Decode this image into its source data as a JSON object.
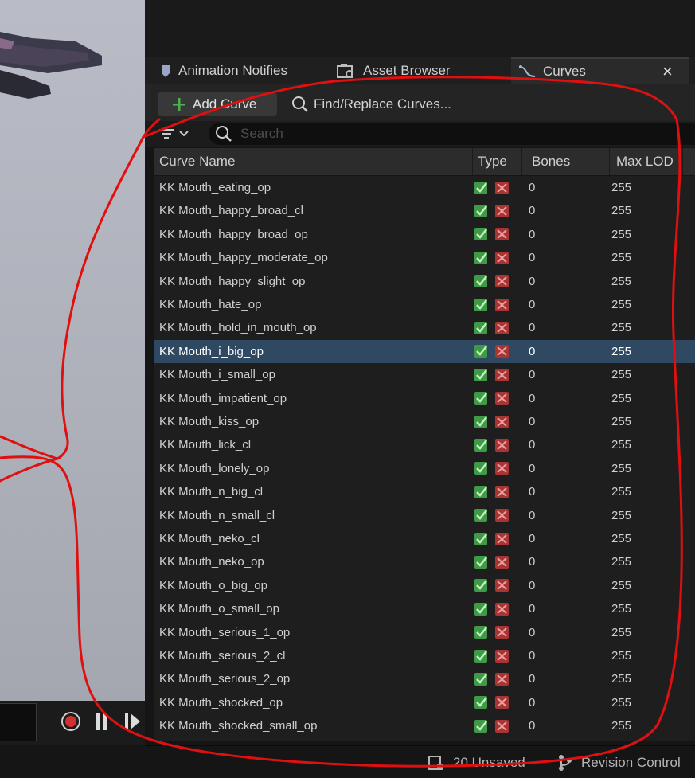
{
  "tabs": [
    {
      "label": "Animation Notifies",
      "icon": "notify-icon"
    },
    {
      "label": "Asset Browser",
      "icon": "asset-browser-icon"
    },
    {
      "label": "Curves",
      "icon": "curves-icon",
      "active": true
    }
  ],
  "tab_close": "×",
  "toolbar": {
    "add_curve_label": "Add Curve",
    "find_replace_label": "Find/Replace Curves..."
  },
  "search": {
    "placeholder": "Search",
    "value": ""
  },
  "columns": {
    "curve_name": "Curve Name",
    "type": "Type",
    "bones": "Bones",
    "max_lod": "Max LOD"
  },
  "rows": [
    {
      "name": "KK Mouth_eating_op",
      "bones": "0",
      "max_lod": "255"
    },
    {
      "name": "KK Mouth_happy_broad_cl",
      "bones": "0",
      "max_lod": "255"
    },
    {
      "name": "KK Mouth_happy_broad_op",
      "bones": "0",
      "max_lod": "255"
    },
    {
      "name": "KK Mouth_happy_moderate_op",
      "bones": "0",
      "max_lod": "255"
    },
    {
      "name": "KK Mouth_happy_slight_op",
      "bones": "0",
      "max_lod": "255"
    },
    {
      "name": "KK Mouth_hate_op",
      "bones": "0",
      "max_lod": "255"
    },
    {
      "name": "KK Mouth_hold_in_mouth_op",
      "bones": "0",
      "max_lod": "255"
    },
    {
      "name": "KK Mouth_i_big_op",
      "bones": "0",
      "max_lod": "255",
      "selected": true
    },
    {
      "name": "KK Mouth_i_small_op",
      "bones": "0",
      "max_lod": "255"
    },
    {
      "name": "KK Mouth_impatient_op",
      "bones": "0",
      "max_lod": "255"
    },
    {
      "name": "KK Mouth_kiss_op",
      "bones": "0",
      "max_lod": "255"
    },
    {
      "name": "KK Mouth_lick_cl",
      "bones": "0",
      "max_lod": "255"
    },
    {
      "name": "KK Mouth_lonely_op",
      "bones": "0",
      "max_lod": "255"
    },
    {
      "name": "KK Mouth_n_big_cl",
      "bones": "0",
      "max_lod": "255"
    },
    {
      "name": "KK Mouth_n_small_cl",
      "bones": "0",
      "max_lod": "255"
    },
    {
      "name": "KK Mouth_neko_cl",
      "bones": "0",
      "max_lod": "255"
    },
    {
      "name": "KK Mouth_neko_op",
      "bones": "0",
      "max_lod": "255"
    },
    {
      "name": "KK Mouth_o_big_op",
      "bones": "0",
      "max_lod": "255"
    },
    {
      "name": "KK Mouth_o_small_op",
      "bones": "0",
      "max_lod": "255"
    },
    {
      "name": "KK Mouth_serious_1_op",
      "bones": "0",
      "max_lod": "255"
    },
    {
      "name": "KK Mouth_serious_2_cl",
      "bones": "0",
      "max_lod": "255"
    },
    {
      "name": "KK Mouth_serious_2_op",
      "bones": "0",
      "max_lod": "255"
    },
    {
      "name": "KK Mouth_shocked_op",
      "bones": "0",
      "max_lod": "255"
    },
    {
      "name": "KK Mouth_shocked_small_op",
      "bones": "0",
      "max_lod": "255"
    }
  ],
  "status": {
    "unsaved": "20 Unsaved",
    "revision_control": "Revision Control"
  },
  "colors": {
    "selected_row": "#2f4962",
    "add_icon": "#4caf50",
    "morph_icon": "#4caf50",
    "material_icon": "#b23a3a",
    "annotation": "#e01010",
    "record": "#d03030"
  }
}
